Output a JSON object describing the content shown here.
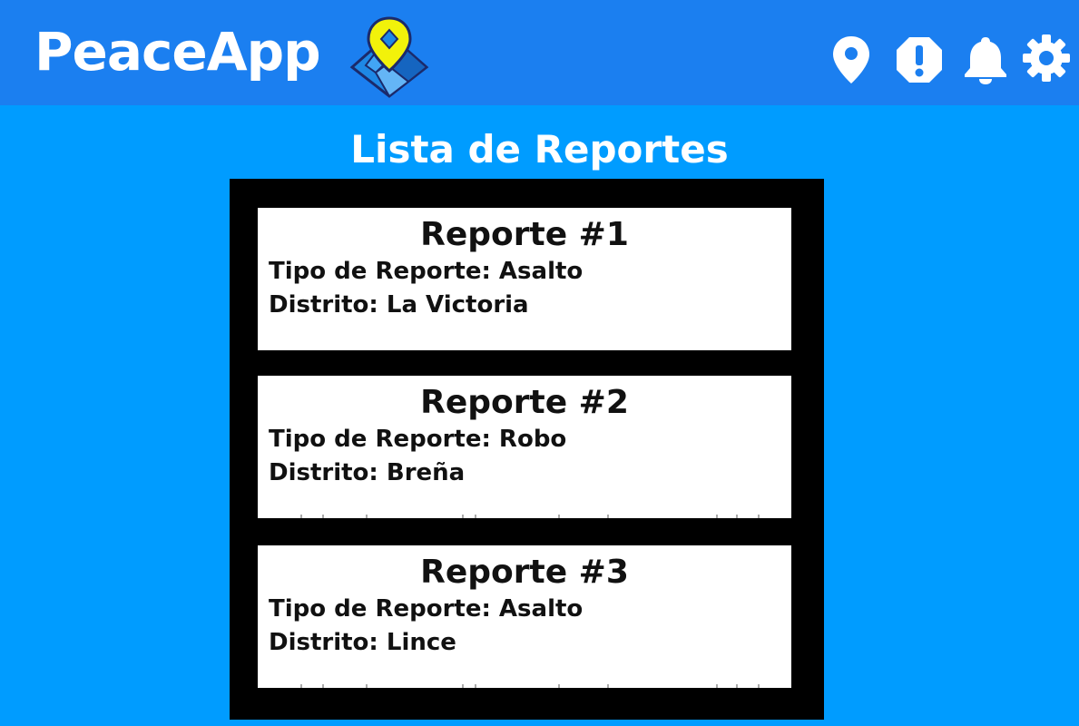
{
  "header": {
    "app_name": "PeaceApp",
    "nav_icons": [
      "location-icon",
      "alert-icon",
      "notification-icon",
      "settings-icon"
    ]
  },
  "colors": {
    "topbar": "#1b7ff0",
    "background": "#009cff",
    "logo_pin": "#f2f20a",
    "logo_map": "#1e88e5"
  },
  "page": {
    "title": "Lista de Reportes"
  },
  "reports": [
    {
      "title": "Reporte #1",
      "type_line": "Tipo de Reporte: Asalto",
      "district_line": "Distrito: La Victoria"
    },
    {
      "title": "Reporte #2",
      "type_line": "Tipo de Reporte: Robo",
      "district_line": "Distrito: Breña"
    },
    {
      "title": "Reporte #3",
      "type_line": "Tipo de Reporte: Asalto",
      "district_line": "Distrito: Lince"
    }
  ]
}
